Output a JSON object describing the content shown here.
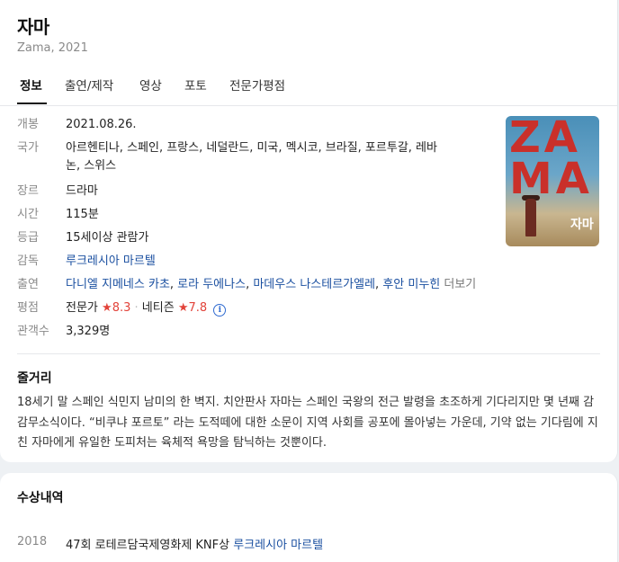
{
  "header": {
    "title": "자마",
    "subtitle": "Zama, 2021"
  },
  "tabs": [
    {
      "label": "정보",
      "active": true
    },
    {
      "label": "출연/제작",
      "active": false
    },
    {
      "label": "영상",
      "active": false
    },
    {
      "label": "포토",
      "active": false
    },
    {
      "label": "전문가평점",
      "active": false
    }
  ],
  "info": {
    "release_label": "개봉",
    "release_value": "2021.08.26.",
    "country_label": "국가",
    "country_value_line1": "아르헨티나, 스페인, 프랑스, 네덜란드, 미국, 멕시코, 브라질, 포르투갈, 레바",
    "country_value_line2": "논, 스위스",
    "genre_label": "장르",
    "genre_value": "드라마",
    "runtime_label": "시간",
    "runtime_value": "115분",
    "rating_label": "등급",
    "rating_value": "15세이상 관람가",
    "director_label": "감독",
    "director_value": "루크레시아 마르텔",
    "cast_label": "출연",
    "cast": [
      "다니엘 지메네스 카초",
      "로라 두에나스",
      "마데우스 나스테르가엘레",
      "후안 미누힌"
    ],
    "cast_more": "더보기",
    "score_label": "평점",
    "critic_label": "전문가",
    "critic_score": "8.3",
    "netizen_label": "네티즌",
    "netizen_score": "7.8",
    "info_icon": "i",
    "audience_label": "관객수",
    "audience_value": "3,329명"
  },
  "poster": {
    "line1": "ZA",
    "line2": "MA",
    "korean_title": "자마"
  },
  "plot": {
    "title": "줄거리",
    "text": "18세기 말 스페인 식민지 남미의 한 벽지. 치안판사 자마는 스페인 국왕의 전근 발령을 초조하게 기다리지만 몇 년째 감감무소식이다. “비쿠냐 포르토” 라는 도적떼에 대한 소문이 지역 사회를 공포에 몰아넣는 가운데, 기약 없는 기다림에 지친 자마에게 유일한 도피처는 육체적 욕망을 탐닉하는 것뿐이다."
  },
  "awards": {
    "title": "수상내역",
    "items": [
      {
        "year": "2018",
        "text": "47회 로테르담국제영화제 KNF상",
        "person": "루크레시아 마르텔"
      }
    ]
  },
  "colors": {
    "link": "#1a4fa0",
    "star": "#e2433a",
    "label": "#8a8a8a"
  }
}
